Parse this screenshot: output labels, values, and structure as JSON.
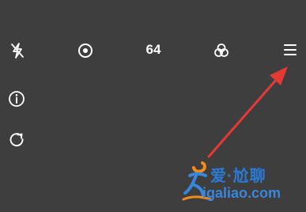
{
  "toolbar": {
    "flash_icon": "flash-off-icon",
    "live_icon": "live-photo-icon",
    "iso_value": "64",
    "filter_icon": "filters-icon",
    "menu_icon": "menu-icon"
  },
  "side": {
    "info_icon": "info-icon",
    "reset_icon": "reset-icon"
  },
  "annotation": {
    "arrow_color": "#e53935"
  },
  "watermark": {
    "cn_text": "爱·尬聊",
    "url_text": "igaliao.com",
    "color": "#2b7bd6"
  }
}
